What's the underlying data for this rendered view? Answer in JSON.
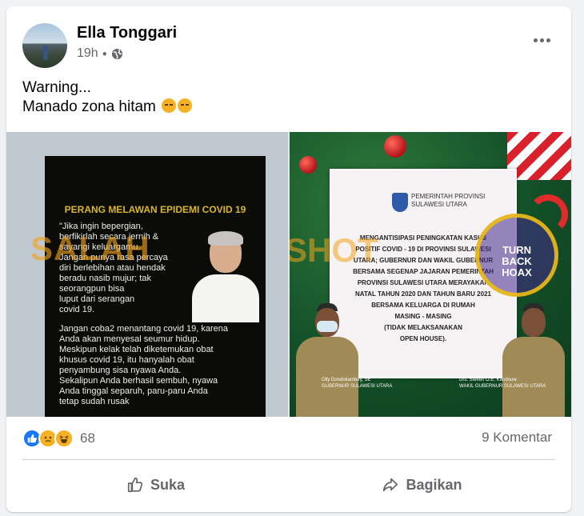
{
  "post": {
    "author": "Ella Tonggari",
    "time": "19h",
    "text_line1": "Warning...",
    "text_line2": "Manado zona hitam"
  },
  "images": {
    "left": {
      "heading": "PERANG MELAWAN EPIDEMI COVID 19",
      "quote": "\"Jika ingin bepergian,\nberfikirlah secara jernih &\nsayangi keluargamu.\nJangan punya rasa percaya\ndiri berlebihan atau hendak\nberadu nasib mujur; tak\nseorangpun bisa\nluput dari serangan\ncovid 19.",
      "body": "Jangan coba2 menantang covid 19, karena\nAnda akan menyesal seumur hidup.\nMeskipun kelak telah diketemukan obat\nkhusus covid 19, itu hanyalah obat\npenyambung sisa nyawa Anda.\nSekalipun Anda berhasil sembuh, nyawa\nAnda tinggal separuh, paru-paru Anda\ntetap sudah rusak",
      "watermark": "SALAH"
    },
    "right": {
      "org": "PEMERINTAH PROVINSI\nSULAWESI UTARA",
      "message": "MENGANTISIPASI PENINGKATAN KASUS\nPOSITIF COVID - 19 DI PROVINSI SULAWESI\nUTARA; GUBERNUR DAN WAKIL GUBERNUR\nBERSAMA SEGENAP JAJARAN PEMERINTAH\nPROVINSI SULAWESI UTARA MERAYAKAN\nNATAL TAHUN 2020 DAN TAHUN BARU 2021\nBERSAMA KELUARGA DI RUMAH\nMASING - MASING\n(TIDAK MELAKSANAKAN\nOPEN HOUSE).",
      "caption_left": "Olly Dondokambey, SE\nGUBERNUR SULAWESI UTARA",
      "caption_right": "Drs. Steven O.E. Kandouw\nWAKIL GUBERNUR SULAWESI UTARA",
      "stamp": "TURN\nBACK\nHOAX",
      "watermark": "SHOT"
    }
  },
  "stats": {
    "reaction_count": "68",
    "comments": "9 Komentar"
  },
  "actions": {
    "like": "Suka",
    "share": "Bagikan"
  },
  "icons": [
    "globe-icon",
    "more-options-icon",
    "like-reaction-icon",
    "sad-reaction-icon",
    "haha-reaction-icon",
    "thumbs-up-icon",
    "share-arrow-icon"
  ],
  "colors": {
    "accent": "#1877f2",
    "muted_text": "#65676b",
    "reaction_yellow": "#f7b125",
    "watermark_orange": "#f4a41c"
  }
}
